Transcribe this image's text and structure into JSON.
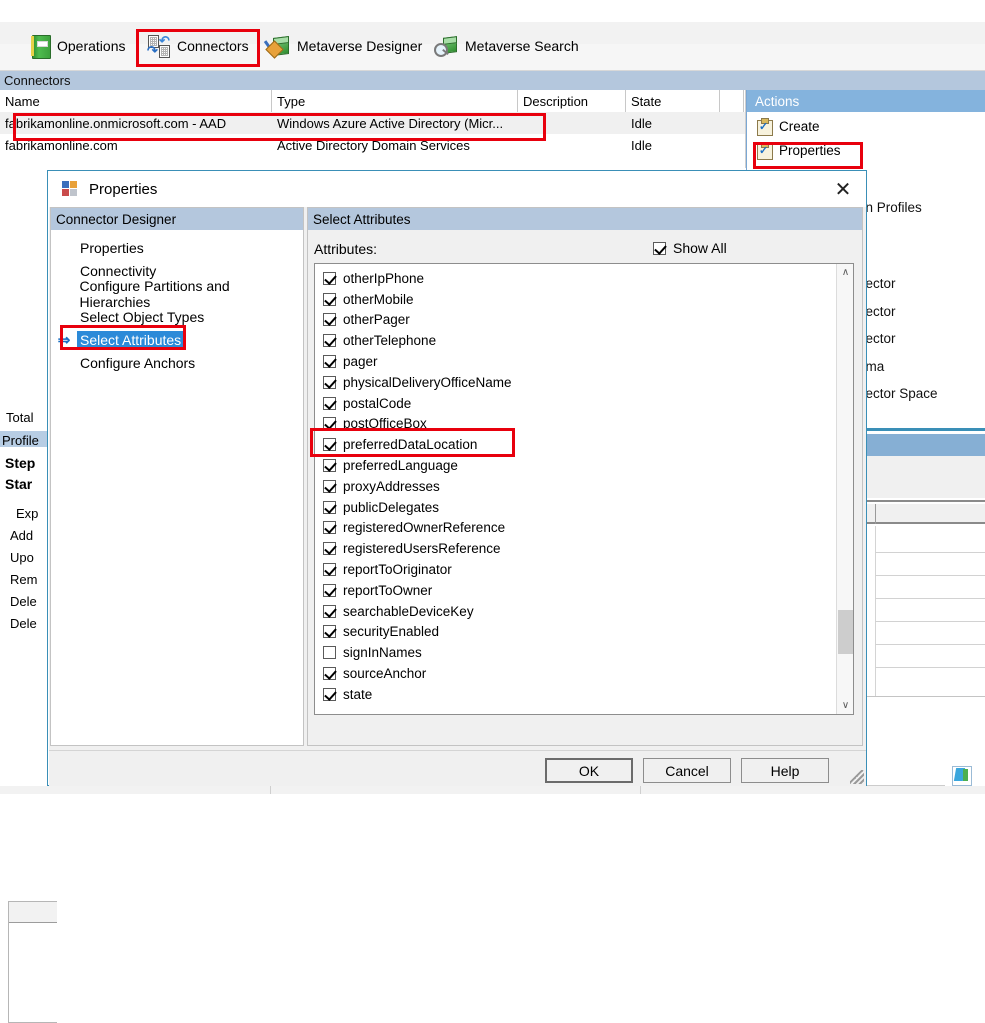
{
  "toolbar": {
    "items": [
      {
        "label": "Operations",
        "icon": "operations-book-icon"
      },
      {
        "label": "Connectors",
        "icon": "connectors-icon"
      },
      {
        "label": "Metaverse Designer",
        "icon": "metaverse-designer-icon"
      },
      {
        "label": "Metaverse Search",
        "icon": "metaverse-search-icon"
      }
    ]
  },
  "connectors_pane": {
    "band_label": "Connectors",
    "columns": [
      "Name",
      "Type",
      "Description",
      "State",
      ""
    ],
    "rows": [
      {
        "name": "fabrikamonline.onmicrosoft.com - AAD",
        "type": "Windows Azure Active Directory (Micr...",
        "description": "",
        "state": "Idle"
      },
      {
        "name": "fabrikamonline.com",
        "type": "Active Directory Domain Services",
        "description": "",
        "state": "Idle"
      }
    ]
  },
  "actions_pane": {
    "title": "Actions",
    "items": [
      {
        "label": "Create",
        "icon": "clipboard-check-icon"
      },
      {
        "label": "Properties",
        "icon": "clipboard-check-icon"
      }
    ],
    "occluded_items": [
      "un Profiles",
      "nector",
      "nector",
      "nector",
      "ema",
      "nector Space"
    ]
  },
  "left_background": {
    "labels": [
      "Total",
      "Profile",
      "Step",
      "Star",
      "Exp",
      "Add",
      "Upo",
      "Rem",
      "Dele",
      "Dele"
    ]
  },
  "dialog": {
    "title": "Properties",
    "close_label": "✕",
    "nav": {
      "header": "Connector Designer",
      "items": [
        {
          "label": "Properties",
          "selected": false
        },
        {
          "label": "Connectivity",
          "selected": false
        },
        {
          "label": "Configure Partitions and Hierarchies",
          "selected": false
        },
        {
          "label": "Select Object Types",
          "selected": false
        },
        {
          "label": "Select Attributes",
          "selected": true
        },
        {
          "label": "Configure Anchors",
          "selected": false
        }
      ],
      "selected_arrow": "⇒"
    },
    "content": {
      "header": "Select Attributes",
      "attributes_label": "Attributes:",
      "show_all_label": "Show All",
      "show_all_checked": true,
      "attributes": [
        {
          "name": "otherIpPhone",
          "checked": true
        },
        {
          "name": "otherMobile",
          "checked": true
        },
        {
          "name": "otherPager",
          "checked": true
        },
        {
          "name": "otherTelephone",
          "checked": true
        },
        {
          "name": "pager",
          "checked": true
        },
        {
          "name": "physicalDeliveryOfficeName",
          "checked": true
        },
        {
          "name": "postalCode",
          "checked": true
        },
        {
          "name": "postOfficeBox",
          "checked": true
        },
        {
          "name": "preferredDataLocation",
          "checked": true
        },
        {
          "name": "preferredLanguage",
          "checked": true
        },
        {
          "name": "proxyAddresses",
          "checked": true
        },
        {
          "name": "publicDelegates",
          "checked": true
        },
        {
          "name": "registeredOwnerReference",
          "checked": true
        },
        {
          "name": "registeredUsersReference",
          "checked": true
        },
        {
          "name": "reportToOriginator",
          "checked": true
        },
        {
          "name": "reportToOwner",
          "checked": true
        },
        {
          "name": "searchableDeviceKey",
          "checked": true
        },
        {
          "name": "securityEnabled",
          "checked": true
        },
        {
          "name": "signInNames",
          "checked": false
        },
        {
          "name": "sourceAnchor",
          "checked": true
        },
        {
          "name": "state",
          "checked": true
        }
      ],
      "scroll_up_glyph": "∧",
      "scroll_down_glyph": "∨"
    },
    "buttons": {
      "ok": "OK",
      "cancel": "Cancel",
      "help": "Help"
    }
  },
  "annotations": {
    "color": "#e8000d",
    "boxes": [
      "connectors-toolbar-highlight",
      "aad-connector-row-highlight",
      "properties-action-highlight",
      "select-attributes-nav-highlight",
      "preferred-data-location-highlight"
    ]
  }
}
